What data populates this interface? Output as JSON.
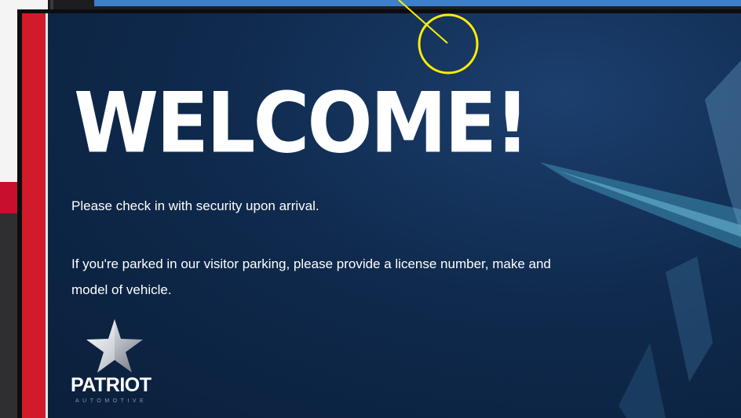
{
  "sign": {
    "heading": "WELCOME!",
    "line1": "Please check in with security upon arrival.",
    "line2": "If you're parked in our visitor parking, please provide a license number, make and model of vehicle."
  },
  "logo": {
    "brand": "PATRIOT",
    "tagline": "AUTOMOTIVE",
    "icon": "star-icon"
  },
  "colors": {
    "navy": "#0f2a4d",
    "accent_red": "#d11a2a",
    "highlight_circle": "#ffee00"
  }
}
